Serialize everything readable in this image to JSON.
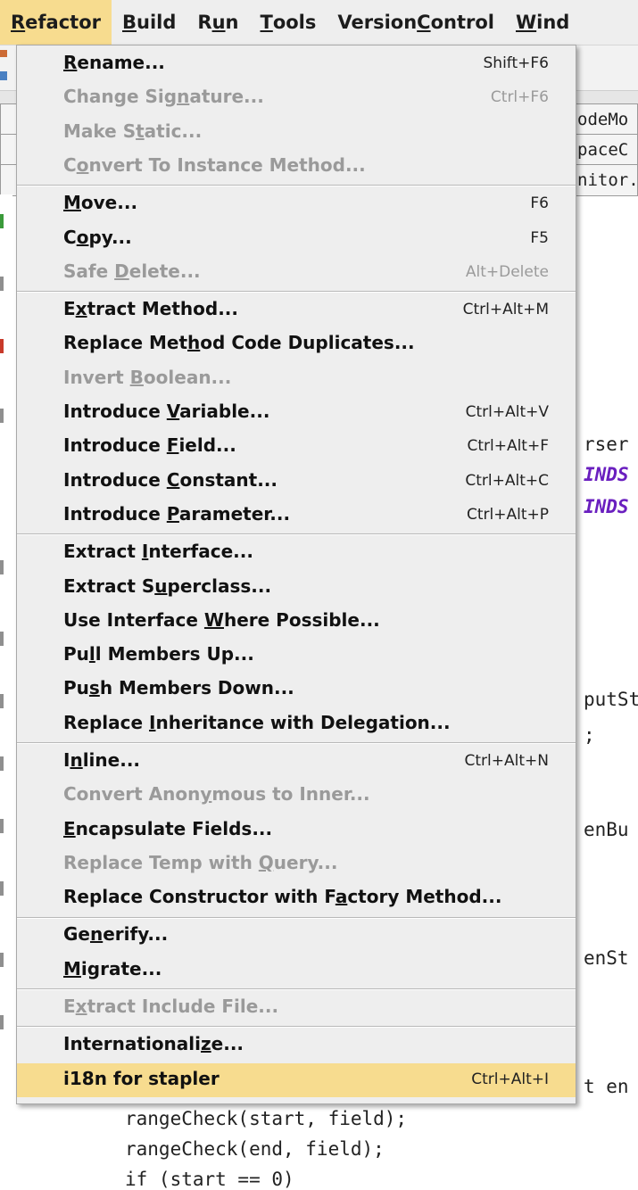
{
  "colors": {
    "highlight": "#f7dc8f",
    "disabled": "#9a9a9a",
    "menu_bg": "#eeeeee"
  },
  "menubar": {
    "items": [
      {
        "pre": "",
        "u": "R",
        "post": "efactor"
      },
      {
        "pre": "",
        "u": "B",
        "post": "uild"
      },
      {
        "pre": "R",
        "u": "u",
        "post": "n"
      },
      {
        "pre": "",
        "u": "T",
        "post": "ools"
      },
      {
        "pre": "Version ",
        "u": "C",
        "post": "ontrol"
      },
      {
        "pre": "",
        "u": "W",
        "post": "ind"
      }
    ]
  },
  "editor": {
    "tabs": [
      "odeMo",
      "paceC",
      "nitor.ja"
    ],
    "code_fragments": [
      "rser",
      "INDS",
      "INDS",
      "putSt",
      ";",
      "enBu",
      "enSt",
      "t en",
      "rangeCheck(start, field);",
      "rangeCheck(end, field);",
      "if (start == 0)"
    ]
  },
  "menu": {
    "groups": [
      [
        {
          "pre": "",
          "u": "R",
          "post": "ename...",
          "sc": "Shift+F6",
          "disabled": false
        },
        {
          "pre": "Change Sig",
          "u": "n",
          "post": "ature...",
          "sc": "Ctrl+F6",
          "disabled": true
        },
        {
          "pre": "Make S",
          "u": "t",
          "post": "atic...",
          "sc": "",
          "disabled": true
        },
        {
          "pre": "C",
          "u": "o",
          "post": "nvert To Instance Method...",
          "sc": "",
          "disabled": true
        }
      ],
      [
        {
          "pre": "",
          "u": "M",
          "post": "ove...",
          "sc": "F6",
          "disabled": false
        },
        {
          "pre": "C",
          "u": "o",
          "post": "py...",
          "sc": "F5",
          "disabled": false
        },
        {
          "pre": "Safe ",
          "u": "D",
          "post": "elete...",
          "sc": "Alt+Delete",
          "disabled": true
        }
      ],
      [
        {
          "pre": "E",
          "u": "x",
          "post": "tract Method...",
          "sc": "Ctrl+Alt+M",
          "disabled": false
        },
        {
          "pre": "Replace Met",
          "u": "h",
          "post": "od Code Duplicates...",
          "sc": "",
          "disabled": false
        },
        {
          "pre": "Invert ",
          "u": "B",
          "post": "oolean...",
          "sc": "",
          "disabled": true
        },
        {
          "pre": "Introduce ",
          "u": "V",
          "post": "ariable...",
          "sc": "Ctrl+Alt+V",
          "disabled": false
        },
        {
          "pre": "Introduce ",
          "u": "F",
          "post": "ield...",
          "sc": "Ctrl+Alt+F",
          "disabled": false
        },
        {
          "pre": "Introduce ",
          "u": "C",
          "post": "onstant...",
          "sc": "Ctrl+Alt+C",
          "disabled": false
        },
        {
          "pre": "Introduce ",
          "u": "P",
          "post": "arameter...",
          "sc": "Ctrl+Alt+P",
          "disabled": false
        }
      ],
      [
        {
          "pre": "Extract ",
          "u": "I",
          "post": "nterface...",
          "sc": "",
          "disabled": false
        },
        {
          "pre": "Extract S",
          "u": "u",
          "post": "perclass...",
          "sc": "",
          "disabled": false
        },
        {
          "pre": "Use Interface ",
          "u": "W",
          "post": "here Possible...",
          "sc": "",
          "disabled": false
        },
        {
          "pre": "Pu",
          "u": "l",
          "post": "l Members Up...",
          "sc": "",
          "disabled": false
        },
        {
          "pre": "Pu",
          "u": "s",
          "post": "h Members Down...",
          "sc": "",
          "disabled": false
        },
        {
          "pre": "Replace ",
          "u": "I",
          "post": "nheritance with Delegation...",
          "sc": "",
          "disabled": false
        }
      ],
      [
        {
          "pre": "I",
          "u": "n",
          "post": "line...",
          "sc": "Ctrl+Alt+N",
          "disabled": false
        },
        {
          "pre": "Convert Anon",
          "u": "y",
          "post": "mous to Inner...",
          "sc": "",
          "disabled": true
        },
        {
          "pre": "",
          "u": "E",
          "post": "ncapsulate Fields...",
          "sc": "",
          "disabled": false
        },
        {
          "pre": "Replace Temp with ",
          "u": "Q",
          "post": "uery...",
          "sc": "",
          "disabled": true
        },
        {
          "pre": "Replace Constructor with F",
          "u": "a",
          "post": "ctory Method...",
          "sc": "",
          "disabled": false
        }
      ],
      [
        {
          "pre": "Ge",
          "u": "n",
          "post": "erify...",
          "sc": "",
          "disabled": false
        },
        {
          "pre": "",
          "u": "M",
          "post": "igrate...",
          "sc": "",
          "disabled": false
        }
      ],
      [
        {
          "pre": "E",
          "u": "x",
          "post": "tract Include File...",
          "sc": "",
          "disabled": true
        }
      ],
      [
        {
          "pre": "Internationali",
          "u": "z",
          "post": "e...",
          "sc": "",
          "disabled": false
        },
        {
          "pre": "i18n for stapler",
          "u": "",
          "post": "",
          "sc": "Ctrl+Alt+I",
          "disabled": false,
          "highlighted": true
        }
      ]
    ]
  }
}
